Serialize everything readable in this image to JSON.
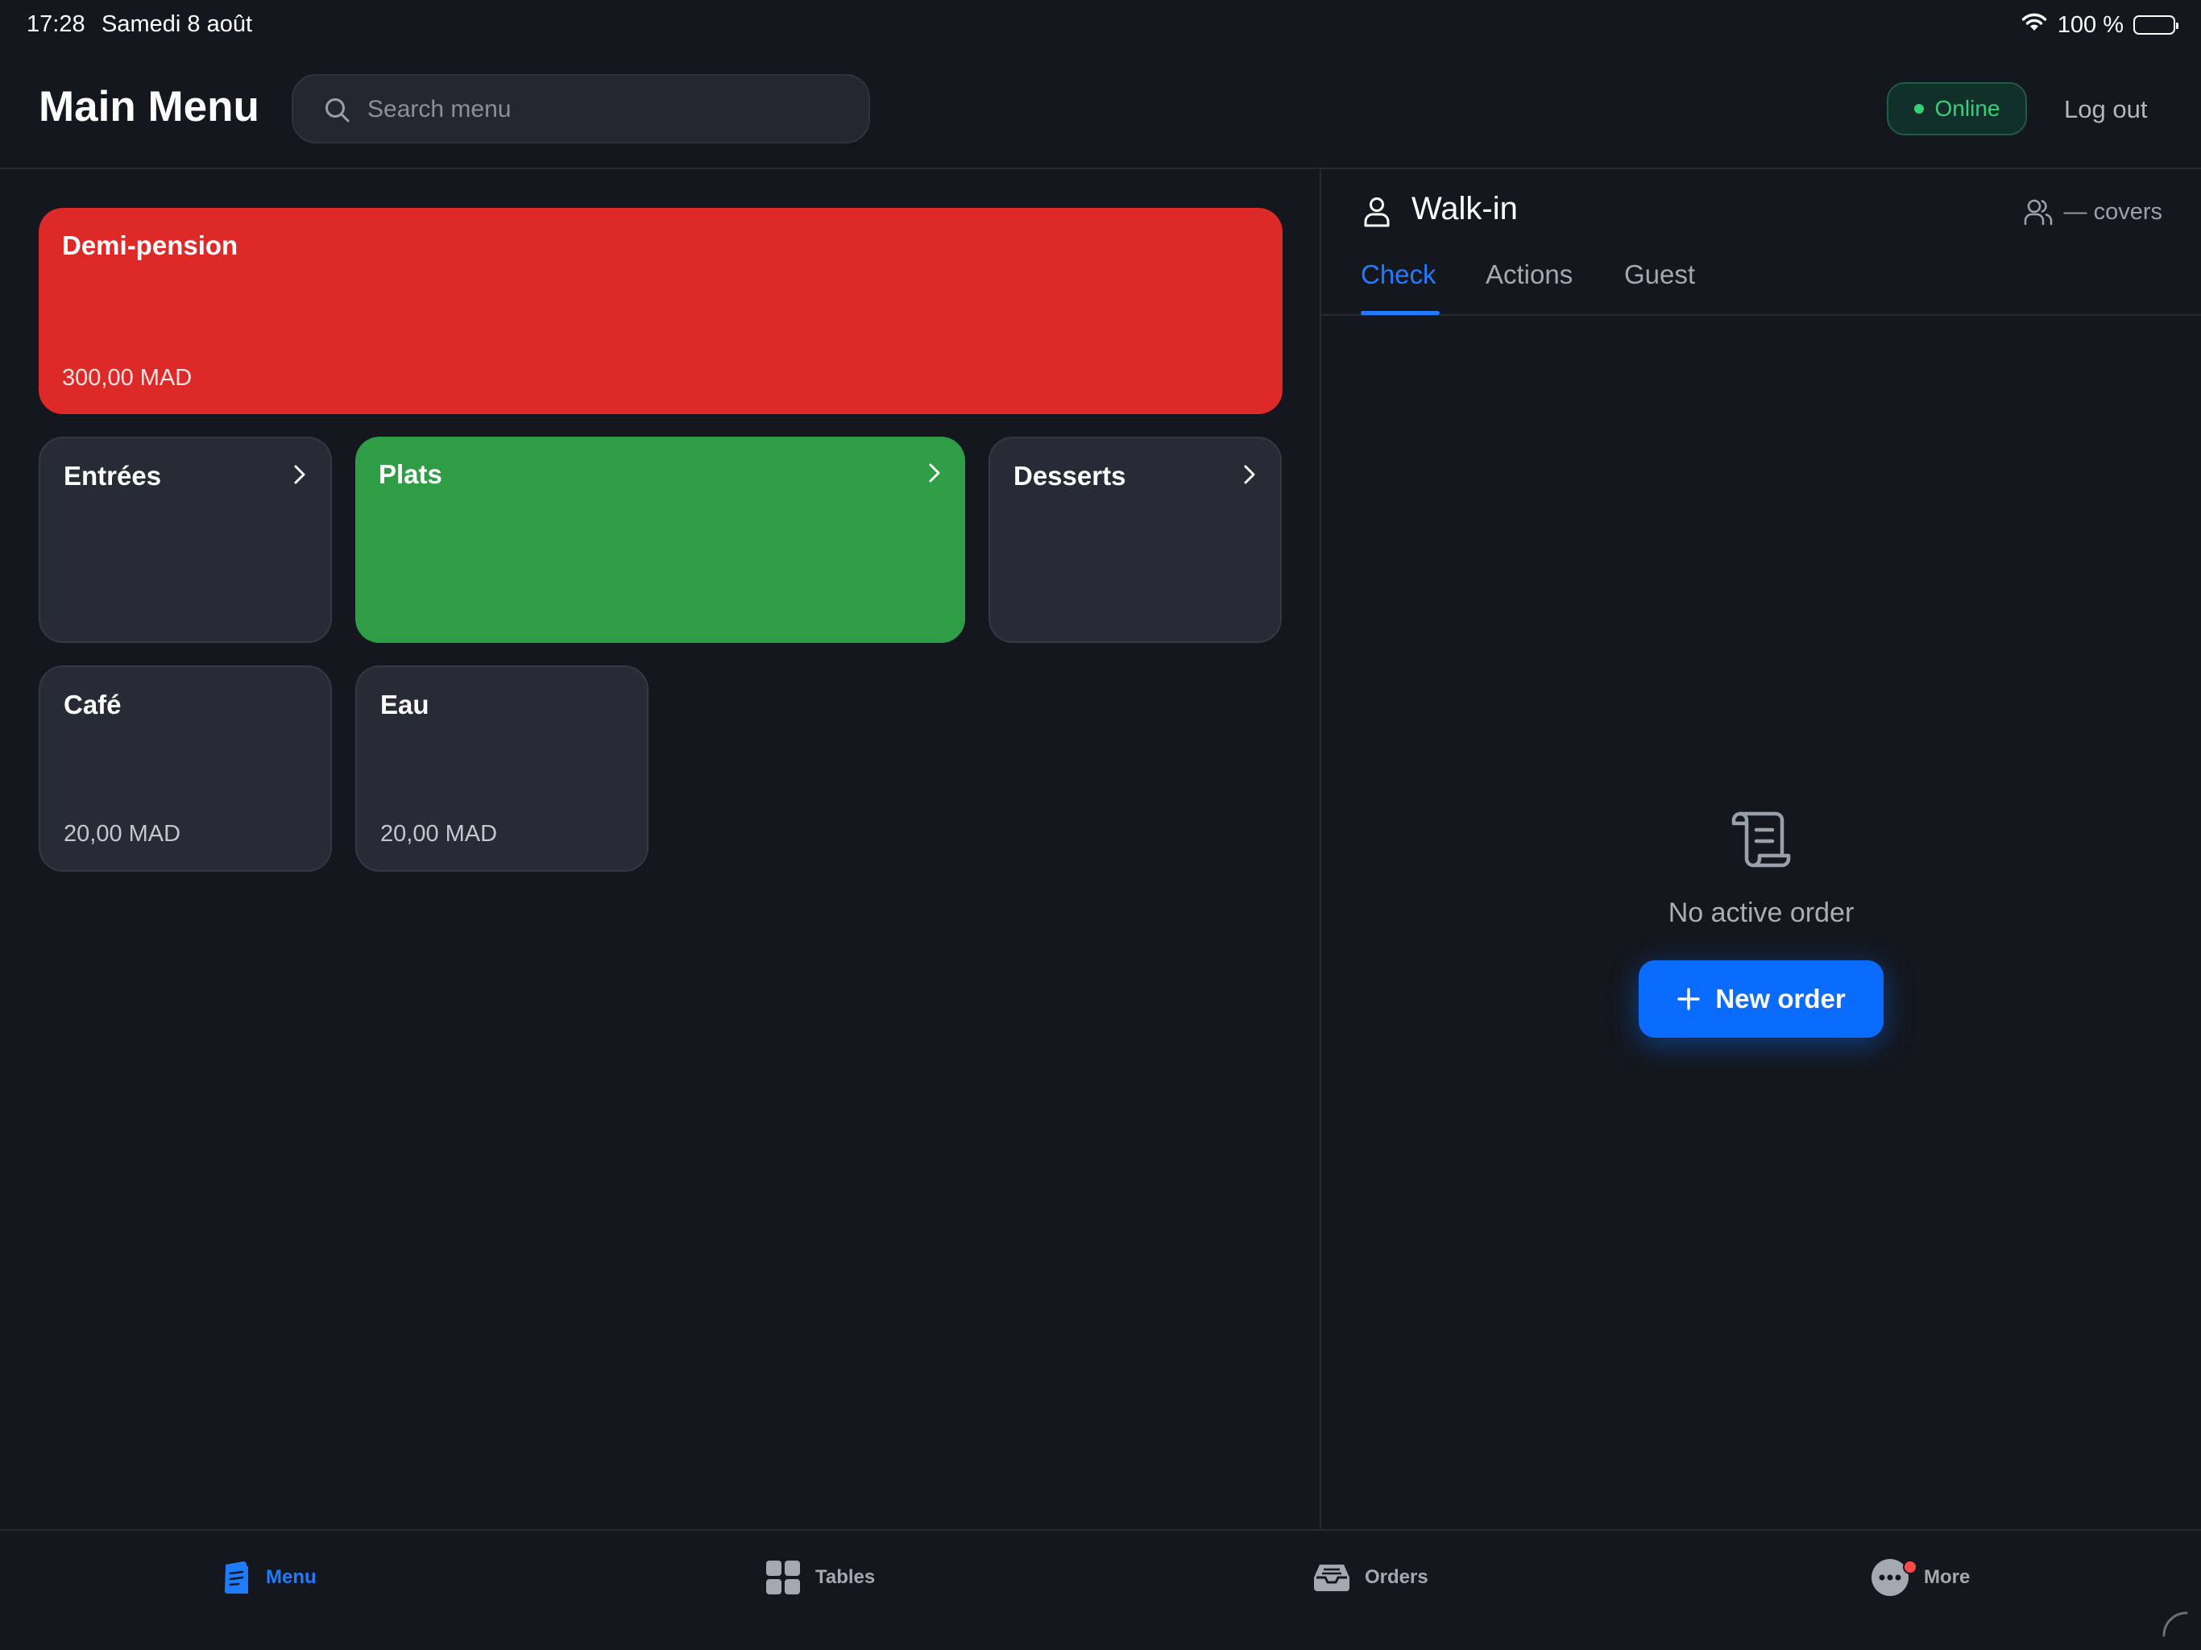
{
  "status_bar": {
    "time": "17:28",
    "date": "Samedi 8 août",
    "battery": "100 %"
  },
  "header": {
    "title": "Main Menu",
    "search_placeholder": "Search menu",
    "status": "Online",
    "logout_label": "Log out"
  },
  "menu": {
    "items": [
      {
        "name": "Demi-pension",
        "price": "300,00 MAD"
      },
      {
        "name": "Entrées"
      },
      {
        "name": "Plats"
      },
      {
        "name": "Desserts"
      },
      {
        "name": "Café",
        "price": "20,00 MAD"
      },
      {
        "name": "Eau",
        "price": "20,00 MAD"
      }
    ]
  },
  "order_panel": {
    "title": "Walk-in",
    "covers": "— covers",
    "tabs": [
      {
        "label": "Check"
      },
      {
        "label": "Actions"
      },
      {
        "label": "Guest"
      }
    ],
    "empty_text": "No active order",
    "new_order_label": "New order"
  },
  "bottom_nav": {
    "items": [
      {
        "label": "Menu"
      },
      {
        "label": "Tables"
      },
      {
        "label": "Orders"
      },
      {
        "label": "More"
      }
    ]
  },
  "colors": {
    "background": "#14171d",
    "accent": "#0a6cff",
    "online": "#34d17a",
    "tile_red": "#dd2a28",
    "tile_green": "#2f9d45",
    "tile_dark": "#272b36"
  }
}
